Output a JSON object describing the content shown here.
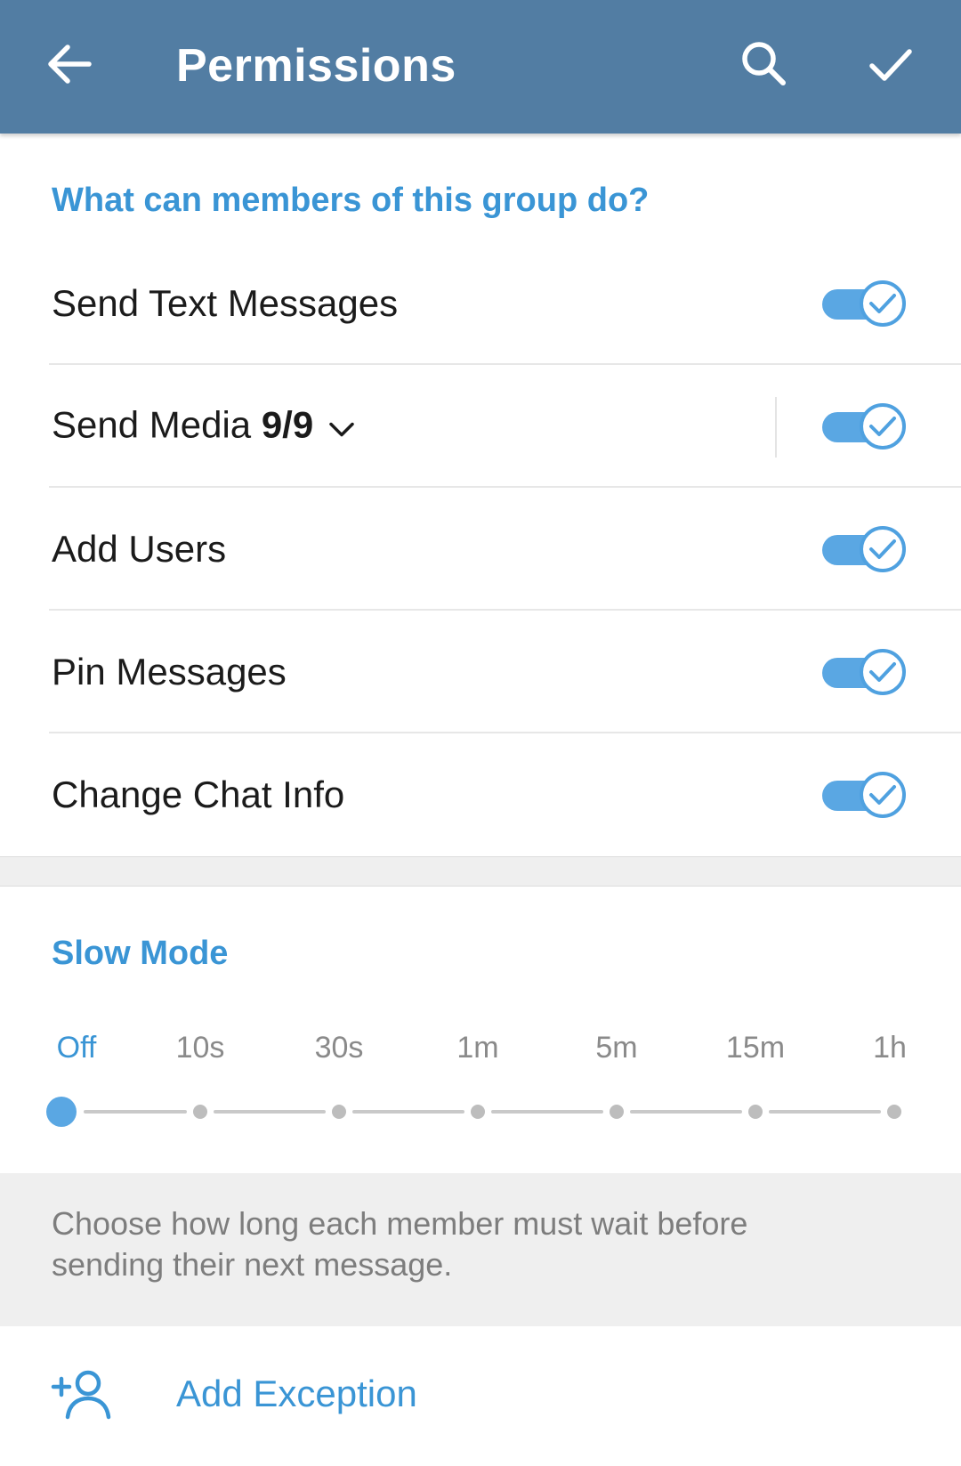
{
  "appbar": {
    "title": "Permissions",
    "back_icon": "arrow-left-icon",
    "search_icon": "search-icon",
    "done_icon": "checkmark-icon"
  },
  "permissions": {
    "header": "What can members of this group do?",
    "items": [
      {
        "label": "Send Text Messages",
        "enabled": true
      },
      {
        "label": "Send Media",
        "count": "9/9",
        "expand_icon": "chevron-down-icon",
        "enabled": true
      },
      {
        "label": "Add Users",
        "enabled": true
      },
      {
        "label": "Pin Messages",
        "enabled": true
      },
      {
        "label": "Change Chat Info",
        "enabled": true
      }
    ]
  },
  "slow_mode": {
    "header": "Slow Mode",
    "options": [
      "Off",
      "10s",
      "30s",
      "1m",
      "5m",
      "15m",
      "1h"
    ],
    "selected": "Off",
    "info": "Choose how long each member must wait before sending their next message."
  },
  "exception": {
    "label": "Add Exception",
    "icon": "add-user-icon"
  },
  "colors": {
    "appbar": "#527da3",
    "accent": "#3a95d5",
    "switch_track": "#5aa7e3"
  }
}
